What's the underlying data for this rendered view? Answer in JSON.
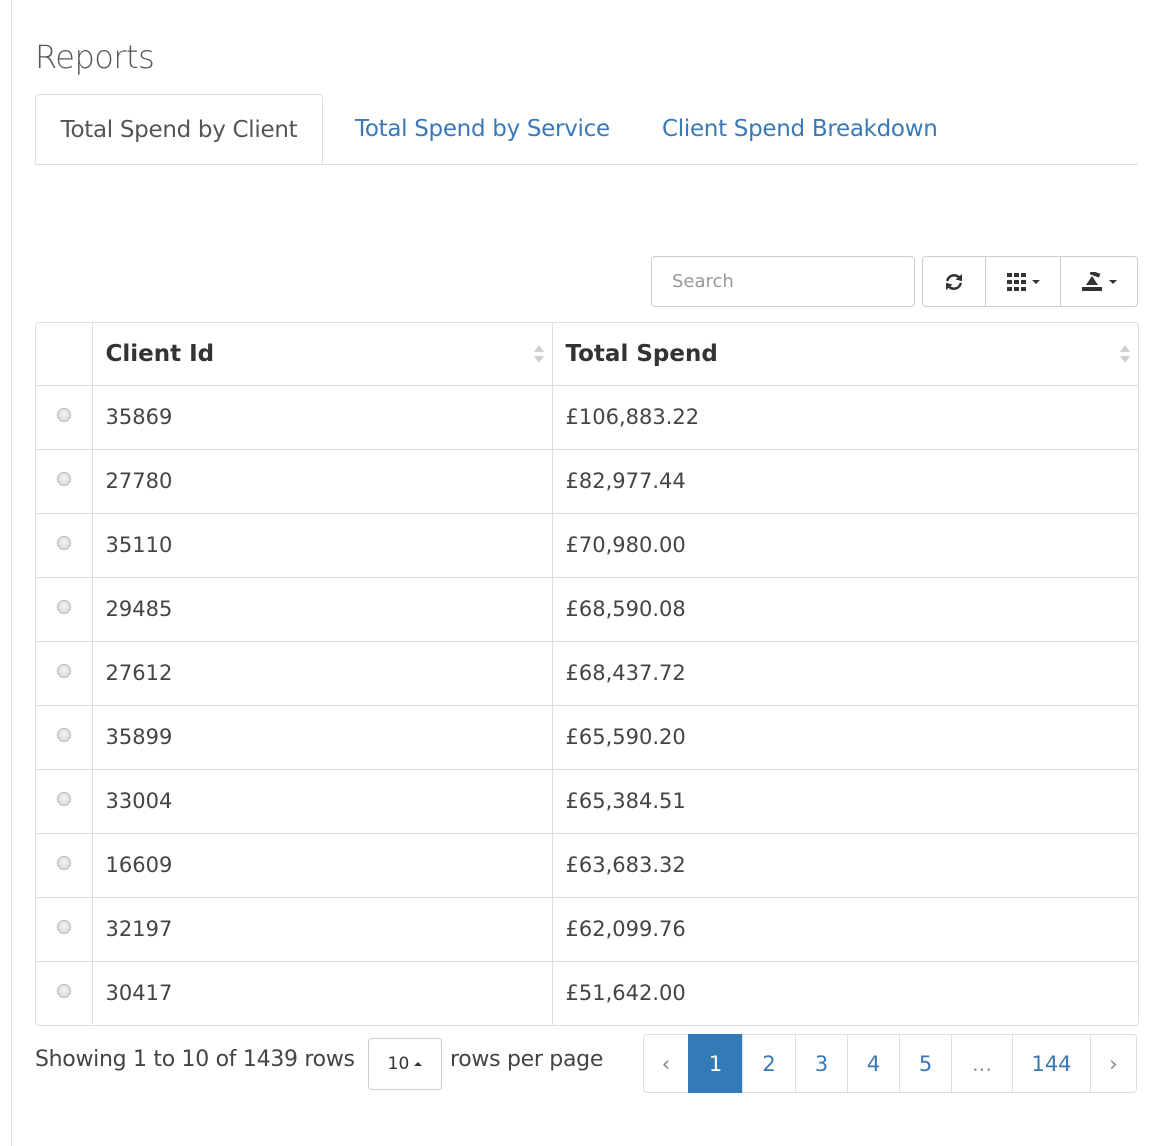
{
  "page": {
    "title": "Reports"
  },
  "tabs": [
    {
      "label": "Total Spend by Client",
      "active": true
    },
    {
      "label": "Total Spend by Service",
      "active": false
    },
    {
      "label": "Client Spend Breakdown",
      "active": false
    }
  ],
  "toolbar": {
    "search_placeholder": "Search",
    "refresh_icon": "refresh-icon",
    "columns_icon": "columns-icon",
    "export_icon": "export-icon"
  },
  "table": {
    "columns": [
      "Client Id",
      "Total Spend"
    ],
    "rows": [
      {
        "client_id": "35869",
        "total_spend": "£106,883.22"
      },
      {
        "client_id": "27780",
        "total_spend": "£82,977.44"
      },
      {
        "client_id": "35110",
        "total_spend": "£70,980.00"
      },
      {
        "client_id": "29485",
        "total_spend": "£68,590.08"
      },
      {
        "client_id": "27612",
        "total_spend": "£68,437.72"
      },
      {
        "client_id": "35899",
        "total_spend": "£65,590.20"
      },
      {
        "client_id": "33004",
        "total_spend": "£65,384.51"
      },
      {
        "client_id": "16609",
        "total_spend": "£63,683.32"
      },
      {
        "client_id": "32197",
        "total_spend": "£62,099.76"
      },
      {
        "client_id": "30417",
        "total_spend": "£51,642.00"
      }
    ]
  },
  "footer": {
    "showing": "Showing 1 to 10 of 1439 rows",
    "page_size": "10",
    "rows_per_page": "rows per page"
  },
  "pagination": {
    "prev": "‹",
    "pages": [
      "1",
      "2",
      "3",
      "4",
      "5",
      "...",
      "144"
    ],
    "next": "›",
    "active": "1"
  },
  "colors": {
    "link": "#3a79b5",
    "active_page": "#337ab7",
    "border": "#dddddd"
  }
}
